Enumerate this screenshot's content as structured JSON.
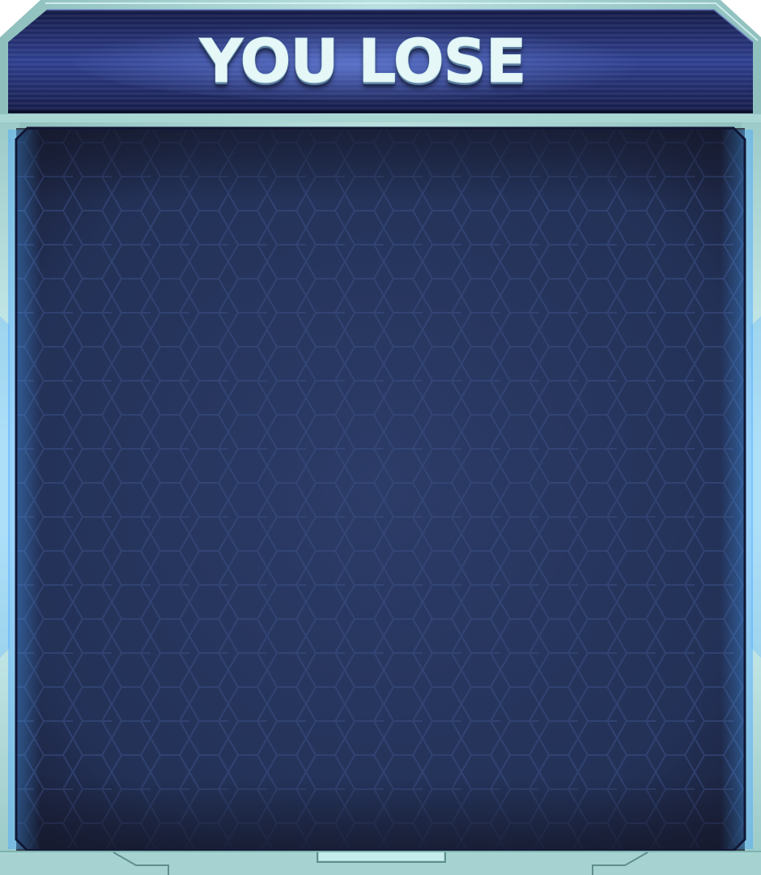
{
  "dialog": {
    "title": "YOU LOSE"
  },
  "colors": {
    "frame": "#9cc9c7",
    "frame_light": "#cdeff0",
    "header_dark": "#172054",
    "header_mid": "#3a4ea0",
    "panel": "#26355f",
    "panel_dark": "#1c2240",
    "hex_line": "#334a7a",
    "glow": "#4aa8ff"
  },
  "icons": {
    "panel_pattern": "hexagon-grid"
  }
}
